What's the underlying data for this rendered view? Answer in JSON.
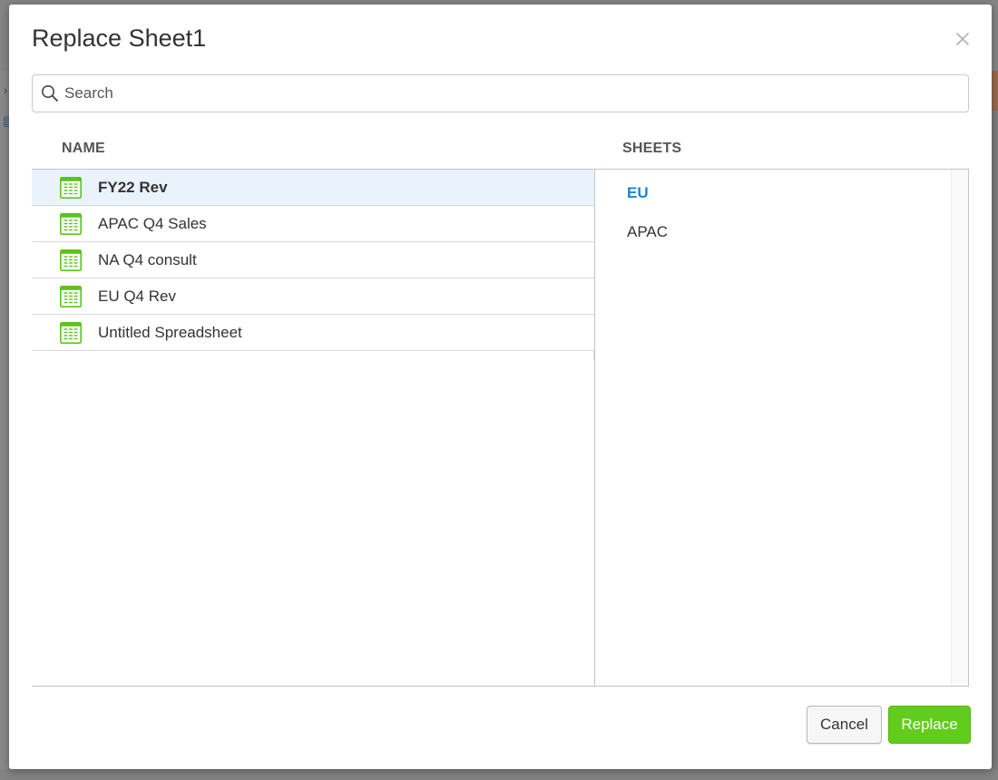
{
  "dialog": {
    "title": "Replace Sheet1",
    "close_icon": "close-icon"
  },
  "search": {
    "placeholder": "Search",
    "value": "",
    "icon": "search-icon"
  },
  "columns": {
    "name": "NAME",
    "sheets": "SHEETS"
  },
  "files": [
    {
      "label": "FY22 Rev",
      "icon": "spreadsheet-icon",
      "selected": true
    },
    {
      "label": "APAC Q4 Sales",
      "icon": "spreadsheet-icon",
      "selected": false
    },
    {
      "label": "NA Q4 consult",
      "icon": "spreadsheet-icon",
      "selected": false
    },
    {
      "label": "EU Q4 Rev",
      "icon": "spreadsheet-icon",
      "selected": false
    },
    {
      "label": "Untitled Spreadsheet",
      "icon": "spreadsheet-icon",
      "selected": false
    }
  ],
  "sheets": [
    {
      "label": "EU",
      "active": true
    },
    {
      "label": "APAC",
      "active": false
    }
  ],
  "buttons": {
    "cancel": "Cancel",
    "replace": "Replace"
  },
  "colors": {
    "accent_blue": "#1a86d0",
    "replace_green": "#62cc1c",
    "icon_green": "#5cc31e",
    "selected_row": "#eaf3fb"
  }
}
